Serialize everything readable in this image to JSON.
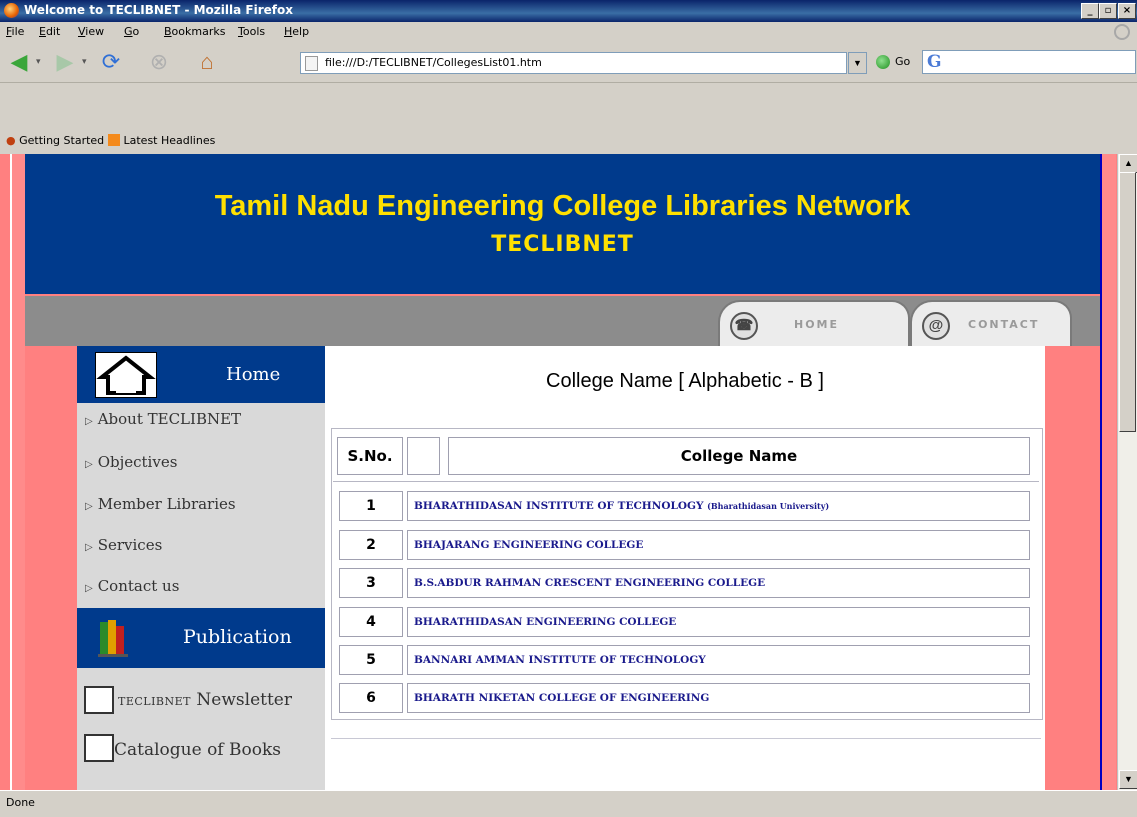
{
  "window": {
    "title": "Welcome to TECLIBNET - Mozilla Firefox"
  },
  "menubar": {
    "items": [
      {
        "ul": "F",
        "rest": "ile"
      },
      {
        "ul": "E",
        "rest": "dit"
      },
      {
        "ul": "V",
        "rest": "iew"
      },
      {
        "ul": "G",
        "rest": "o"
      },
      {
        "ul": "B",
        "rest": "ookmarks"
      },
      {
        "ul": "T",
        "rest": "ools"
      },
      {
        "ul": "H",
        "rest": "elp"
      }
    ]
  },
  "toolbar": {
    "url": "file:///D:/TECLIBNET/CollegesList01.htm",
    "go_label": "Go"
  },
  "bookmarks": [
    "Getting Started",
    "Latest Headlines"
  ],
  "site": {
    "title": "Tamil Nadu Engineering College Libraries Network",
    "acronym": "TECLIBNET",
    "tabs": [
      "HOME",
      "CONTACT"
    ]
  },
  "sidebar": {
    "home_label": "Home",
    "items": [
      "About TECLIBNET",
      "Objectives",
      "Member Libraries",
      "Services",
      "Contact us"
    ],
    "publication_label": "Publication",
    "newsletter_prefix": "TECLIBNET",
    "newsletter_label": "Newsletter",
    "catalogue_label": "Catalogue of Books"
  },
  "main": {
    "title": "College Name [ Alphabetic - B ]",
    "headers": {
      "sno": "S.No.",
      "name": "College Name"
    },
    "rows": [
      {
        "sno": "1",
        "name": "BHARATHIDASAN INSTITUTE OF TECHNOLOGY",
        "sub": "(Bharathidasan University)"
      },
      {
        "sno": "2",
        "name": "BHAJARANG ENGINEERING COLLEGE",
        "sub": ""
      },
      {
        "sno": "3",
        "name": "B.S.ABDUR RAHMAN CRESCENT ENGINEERING COLLEGE",
        "sub": ""
      },
      {
        "sno": "4",
        "name": "BHARATHIDASAN ENGINEERING COLLEGE",
        "sub": ""
      },
      {
        "sno": "5",
        "name": "BANNARI AMMAN INSTITUTE OF TECHNOLOGY",
        "sub": ""
      },
      {
        "sno": "6",
        "name": "BHARATH NIKETAN COLLEGE OF ENGINEERING",
        "sub": ""
      }
    ]
  },
  "status": {
    "text": "Done"
  }
}
